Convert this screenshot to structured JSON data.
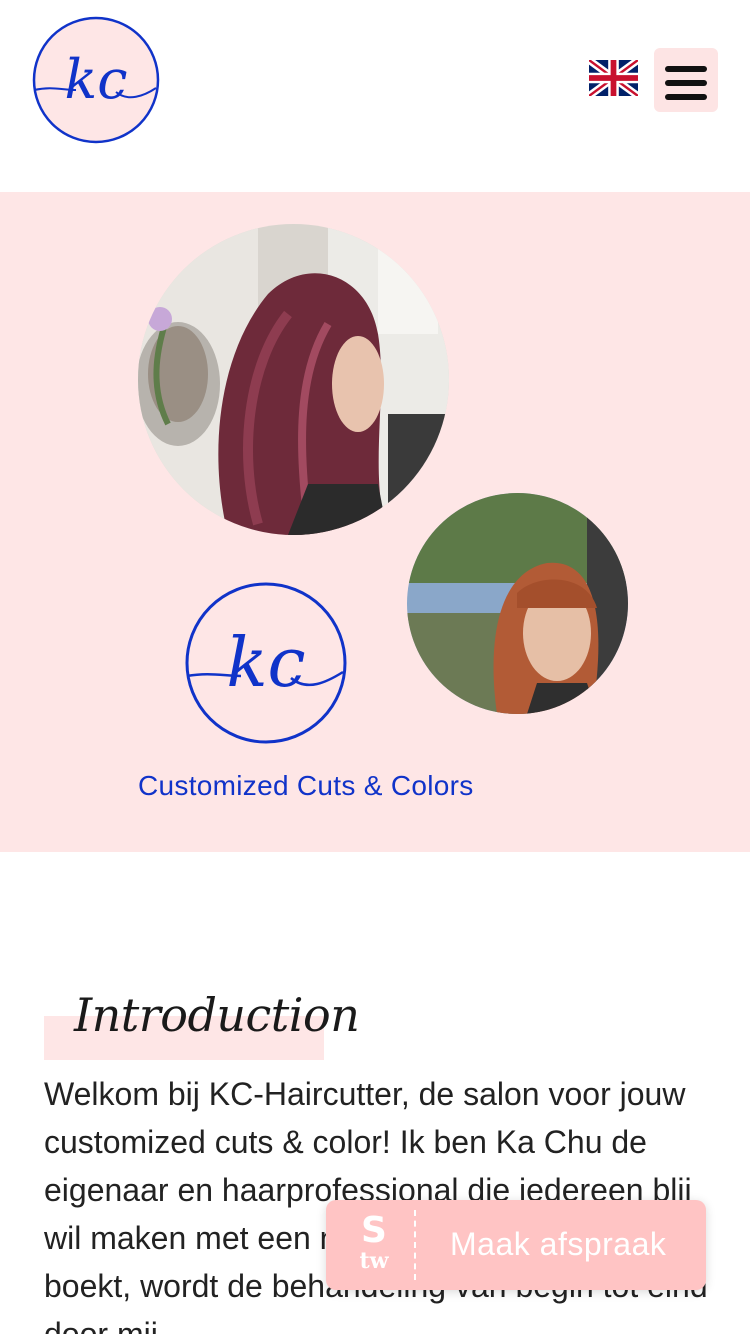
{
  "header": {
    "logo_text": "kc",
    "language_flag": "uk-flag-icon",
    "menu_icon": "hamburger-icon"
  },
  "hero": {
    "photo_1": "portrait of woman with long burgundy hair in salon",
    "photo_2": "portrait of woman with copper bob and bangs outdoors",
    "logo_text": "kc",
    "tagline": "Customized Cuts & Colors"
  },
  "intro": {
    "heading": "Introduction",
    "body": "Welkom bij KC-Haircutter, de salon voor jouw customized cuts & color! Ik ben Ka Chu de eigenaar en haarprofessional die iedereen blij wil maken met een nieuwe look. Als je bij mij boekt, wordt de behandeling van begin tot eind door mij"
  },
  "booking": {
    "icon_top": "S",
    "icon_bottom": "tw",
    "label": "Maak afspraak"
  },
  "colors": {
    "brand_blue": "#1033c9",
    "pink_bg": "#fee6e6",
    "button_pink": "#ffc4c4"
  }
}
